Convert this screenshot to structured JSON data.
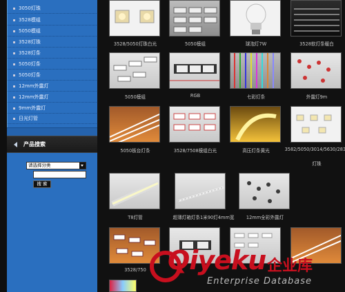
{
  "sidebar": {
    "categories": [
      {
        "label": "3050灯珠"
      },
      {
        "label": "3528模组"
      },
      {
        "label": "5050模组"
      },
      {
        "label": "3528灯珠"
      },
      {
        "label": "3528灯条"
      },
      {
        "label": "5050灯条"
      },
      {
        "label": "5050灯条"
      },
      {
        "label": "12mm外露灯"
      },
      {
        "label": "12mm外露灯"
      },
      {
        "label": "9mm外露灯"
      },
      {
        "label": "日光灯管"
      }
    ],
    "search": {
      "title": "产品搜索",
      "select_value": "请选择分类",
      "button_label": "搜 索"
    }
  },
  "products": [
    {
      "caption": "3528/5050灯珠白光"
    },
    {
      "caption": "5050模组"
    },
    {
      "caption": "球泡灯7W"
    },
    {
      "caption": "3528软灯条暖白"
    },
    {
      "caption": "5050模组"
    },
    {
      "caption": "RGB"
    },
    {
      "caption": "七彩灯条"
    },
    {
      "caption": "外露灯9m"
    },
    {
      "caption": "5050板台灯条"
    },
    {
      "caption": "3528/7508模组白光"
    },
    {
      "caption": "高压灯条黄光"
    },
    {
      "caption": "3582/5050/3014/5630/2835"
    },
    {
      "caption": "灯珠"
    },
    {
      "caption": "T8灯管"
    },
    {
      "caption": "超薄灯箱灯条1米90灯4mm宽"
    },
    {
      "caption": "12mm全彩外露灯"
    },
    {
      "caption": "3528/750"
    }
  ],
  "watermark": {
    "brand": "Qiyeku",
    "cn": "企业库",
    "sub": "Enterprise Database"
  },
  "colors": {
    "sidebar_blue": "#2a6fbf",
    "watermark_red": "#c80f1e",
    "background": "#111111"
  }
}
